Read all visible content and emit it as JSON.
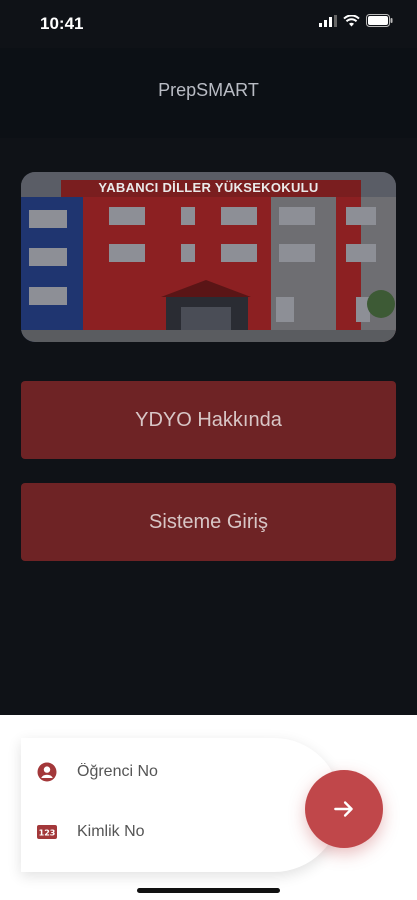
{
  "status_bar": {
    "time": "10:41"
  },
  "app": {
    "title": "PrepSMART"
  },
  "banner": {
    "sign_text": "YABANCI DİLLER YÜKSEKOKULU"
  },
  "menu": {
    "about_label": "YDYO Hakkında",
    "login_label": "Sisteme Giriş"
  },
  "login": {
    "student_no_placeholder": "Öğrenci No",
    "student_no_value": "",
    "id_no_placeholder": "Kimlik No",
    "id_no_value": "",
    "submit_icon": "arrow-right-icon"
  },
  "colors": {
    "button_red": "#6e2325",
    "accent_red": "#c0474a",
    "background": "#0f1217"
  }
}
